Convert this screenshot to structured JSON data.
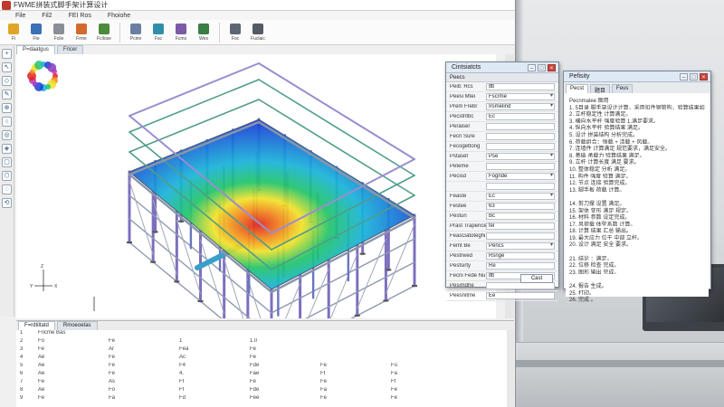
{
  "window": {
    "title": "FWME拼装式脚手架计算设计"
  },
  "menu": [
    "File",
    "Fil2",
    "FEI Ros",
    "Fhoiohe"
  ],
  "ribbon": [
    {
      "label": "Fi",
      "icon": "open-folder-icon",
      "color": "#e0a526"
    },
    {
      "label": "Fte",
      "icon": "save-icon",
      "color": "#3b6fb6"
    },
    {
      "label": "Fcile",
      "icon": "document-icon",
      "color": "#8a8f96"
    },
    {
      "label": "Frme",
      "icon": "edit-icon",
      "color": "#d26a2d"
    },
    {
      "label": "Fcilose",
      "icon": "print-icon",
      "color": "#4b8b3b"
    },
    {
      "label": "Pcine",
      "icon": "grid-icon",
      "color": "#6b7fa3"
    },
    {
      "label": "Fsc",
      "icon": "layers-icon",
      "color": "#2f8fa8"
    },
    {
      "label": "Fcms",
      "icon": "measure-icon",
      "color": "#7b5aa6"
    },
    {
      "label": "Wes",
      "icon": "chart-icon",
      "color": "#3a7d44"
    },
    {
      "label": "Foc",
      "icon": "window-icon",
      "color": "#5e6673"
    },
    {
      "label": "Fuclaic",
      "icon": "gear-icon",
      "color": "#555b63"
    }
  ],
  "left_toolbar": [
    "+",
    "↖",
    "◇",
    "✎",
    "⊕",
    "○",
    "◎",
    "◈",
    "▢",
    "⬡",
    "◌",
    "⟲"
  ],
  "doc_tabs": [
    {
      "label": "P=daatgus"
    },
    {
      "label": "Fricer"
    }
  ],
  "axis_labels": {
    "z": "Z",
    "x": "X",
    "y": "Y"
  },
  "properties": {
    "title": "Cintsiatcts",
    "header": "Peecs",
    "rows": [
      {
        "key": "Peib: Rcs",
        "value": "图",
        "dd": false
      },
      {
        "key": "Peesi Mtei",
        "value": "Fscrme",
        "dd": true
      },
      {
        "key": "Prem Frebr",
        "value": "Irsmelind",
        "dd": true
      },
      {
        "key": "Pecstntbc",
        "value": "Ec",
        "dd": false
      },
      {
        "key": "Peraiser",
        "value": "",
        "dd": false
      },
      {
        "key": "Fecri Sure",
        "value": "",
        "dd": false
      },
      {
        "key": "Fecogettong",
        "value": "",
        "dd": false
      },
      {
        "key": "Pstaset",
        "value": "Pse",
        "dd": true
      },
      {
        "key": "Peteme",
        "value": "",
        "dd": false
      },
      {
        "key": "Pecisd",
        "value": "Fognde",
        "dd": true
      },
      {
        "key": "",
        "value": "",
        "dd": false
      },
      {
        "key": "Feaste",
        "value": "Ec",
        "dd": true
      },
      {
        "key": "Festee",
        "value": "63",
        "dd": false
      },
      {
        "key": "Pestun",
        "value": "Bc",
        "dd": false
      },
      {
        "key": "Prast Trapence",
        "value": "fel",
        "dd": false
      },
      {
        "key": "FeasGatoteghi",
        "value": "",
        "dd": false
      },
      {
        "key": "Femt Be",
        "value": "Pencs",
        "dd": true
      },
      {
        "key": "Pestrwed",
        "value": "Rsnge",
        "dd": false
      },
      {
        "key": "Pestsirty",
        "value": "Re",
        "dd": false
      },
      {
        "key": "Fecni Fede Nu",
        "value": "图",
        "dd": false
      },
      {
        "key": "Pesimdhe",
        "value": "",
        "dd": false
      },
      {
        "key": "Peesnitme",
        "value": "Ee",
        "dd": false
      }
    ],
    "button": "Cast"
  },
  "log": {
    "title": "Pefisity",
    "tabs": [
      "Pecst",
      "题目",
      "Feus"
    ],
    "lines": [
      "Pecnmalee 图用",
      "1. 5目录 脚手架设计计算，采用扣件钢管构，验算结果如下。",
      "2. 立杆稳定性 计算满足。",
      "3. 横向水平杆 强度验算 1.满足要求。",
      "4. 纵向水平杆 验算结果 满足。",
      "5. 设计 拼装结构 分析完成。",
      "6. 荷载组合：恒载 + 活载 + 风载。",
      "7. 连墙件 计算满足 规范要求，满足安全。",
      "8. 基础 承载力 验算结果 满足。",
      "9. 立杆 计算长度 满足 要求。",
      "10. 整体稳定 分析 满足。",
      "11. 构件 强度 验算 满足。",
      "12. 节点 连接 验算完成。",
      "13. 脚手板 荷载 计算。",
      "",
      "14. 剪刀撑 设置 满足。",
      "15. 架体 变形 满足 规定。",
      "16. 材料 参数 设定完成。",
      "17. 风荷载 体型系数 计算。",
      "18. 计算 结果 汇总 输出。",
      "19. 最大应力 位于 中部 立杆。",
      "20. 设计 满足 安全 要求。",
      "",
      "21. 结论 ：满足。",
      "22. 位移 检查 完成。",
      "23. 图形 输出 完成。",
      "",
      "24. 报告 生成。",
      "25. 打印。",
      "26. 完成 。"
    ]
  },
  "output": {
    "tabs": [
      "F=rdtiltatd",
      "Rmoeoetas"
    ],
    "rows": [
      [
        "1",
        "Fricme Bas",
        "",
        "",
        "",
        "",
        ""
      ],
      [
        "2",
        "Fo",
        "Fe",
        "1",
        "1.0",
        "",
        ""
      ],
      [
        "3",
        "Fe",
        "Ar",
        "Fea",
        "Fe",
        "",
        ""
      ],
      [
        "4",
        "Ae",
        "Fe",
        "Ac",
        "Fe",
        "",
        ""
      ],
      [
        "5",
        "Ae",
        "Fe",
        "F4",
        "Fde",
        "Fe",
        "Fu"
      ],
      [
        "6",
        "Ae",
        "Fe",
        "4.",
        "Fae",
        "Ft",
        "Fa"
      ],
      [
        "7",
        "Fe",
        "As",
        "Ft",
        "Fe",
        "Fe",
        "Ff"
      ],
      [
        "8",
        "Ae",
        "Fo",
        "Ft",
        "Fde",
        "Fa",
        "Fe"
      ],
      [
        "9",
        "Fe",
        "Fa",
        "Fd",
        "Fee",
        "Fe",
        "Fe"
      ]
    ]
  },
  "colors": {
    "low": "#1a3fd6",
    "mid": "#22c46a",
    "high": "#f2e22a",
    "peak": "#e0241b",
    "steel": "#8b95a8"
  }
}
